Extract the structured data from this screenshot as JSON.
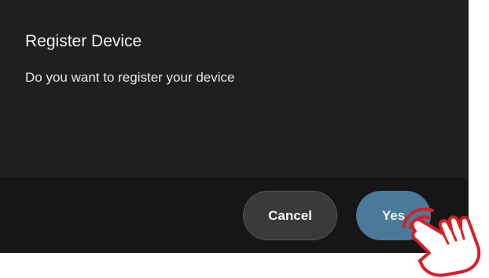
{
  "dialog": {
    "title": "Register Device",
    "message": "Do you want to register your device",
    "cancel_label": "Cancel",
    "confirm_label": "Yes"
  },
  "pointer": {
    "icon": "tap-hand-icon",
    "color": "#d81f26"
  },
  "colors": {
    "dialog_background": "#1f1f1f",
    "confirm_button": "#4a7a99",
    "cancel_button": "#3a3a3a"
  }
}
